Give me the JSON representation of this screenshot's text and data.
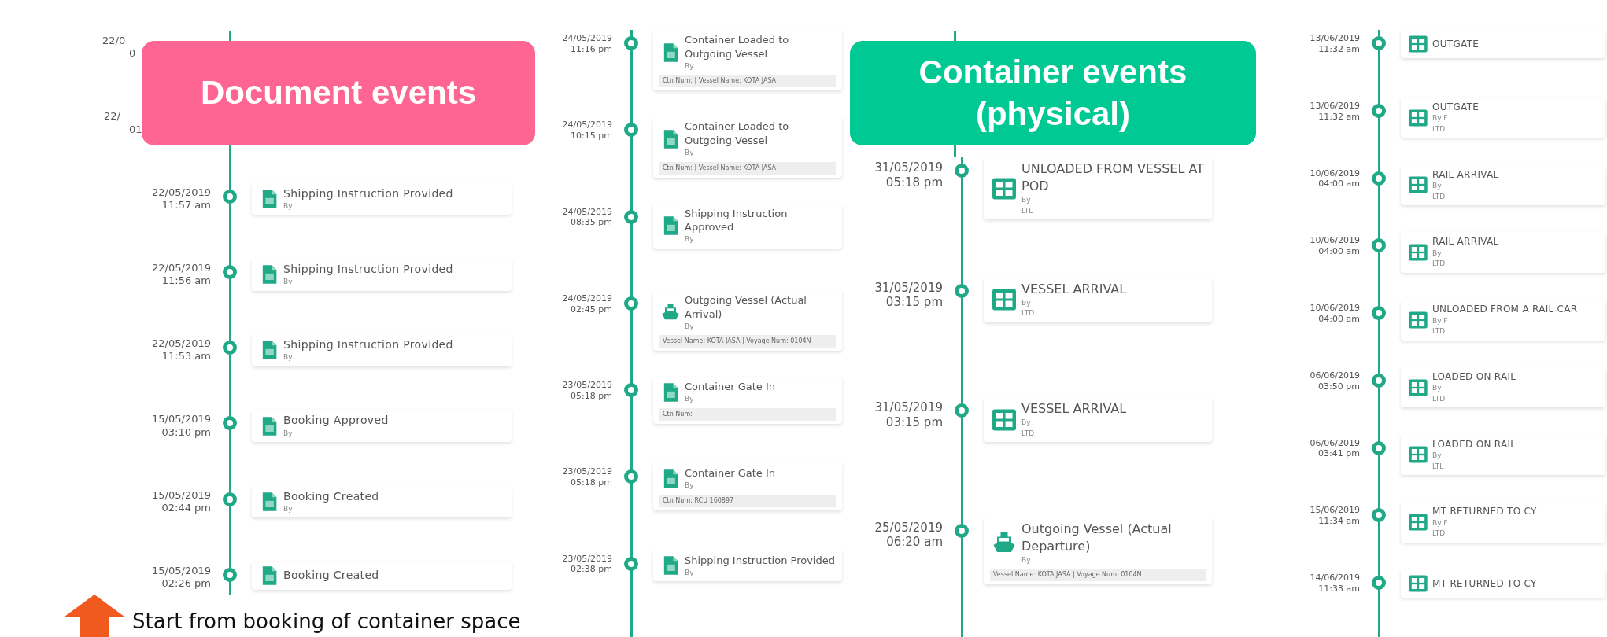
{
  "panels": [
    {
      "events": [
        {
          "date": "22/0",
          "time": "0",
          "kind": "covered"
        },
        {
          "date": "22/",
          "time": "01",
          "kind": "covered"
        },
        {
          "date": "22/05/2019",
          "time": "11:57 am",
          "kind": "document",
          "title": "Shipping Instruction Provided",
          "by": "By"
        },
        {
          "date": "22/05/2019",
          "time": "11:56 am",
          "kind": "document",
          "title": "Shipping Instruction Provided",
          "by": "By"
        },
        {
          "date": "22/05/2019",
          "time": "11:53 am",
          "kind": "document",
          "title": "Shipping Instruction Provided",
          "by": "By"
        },
        {
          "date": "15/05/2019",
          "time": "03:10 pm",
          "kind": "document",
          "title": "Booking Approved",
          "by": "By"
        },
        {
          "date": "15/05/2019",
          "time": "02:44 pm",
          "kind": "document",
          "title": "Booking Created",
          "by": "By"
        },
        {
          "date": "15/05/2019",
          "time": "02:26 pm",
          "kind": "document",
          "title": "Booking Created"
        }
      ]
    },
    {
      "events": [
        {
          "date": "24/05/2019",
          "time": "11:16 pm",
          "kind": "document",
          "title": "Container Loaded to Outgoing Vessel",
          "by": "By",
          "detail": "Ctn Num: | Vessel Name: KOTA JASA"
        },
        {
          "date": "24/05/2019",
          "time": "10:15 pm",
          "kind": "document",
          "title": "Container Loaded to Outgoing Vessel",
          "by": "By",
          "detail": "Ctn Num: | Vessel Name: KOTA JASA"
        },
        {
          "date": "24/05/2019",
          "time": "08:35 pm",
          "kind": "document",
          "title": "Shipping Instruction Approved",
          "by": "By"
        },
        {
          "date": "24/05/2019",
          "time": "02:45 pm",
          "kind": "ship",
          "title": "Outgoing Vessel (Actual Arrival)",
          "by": "By",
          "detail": "Vessel Name: KOTA JASA | Voyage Num: 0104N"
        },
        {
          "date": "23/05/2019",
          "time": "05:18 pm",
          "kind": "document",
          "title": "Container Gate In",
          "by": "By",
          "detail": "Ctn Num:"
        },
        {
          "date": "23/05/2019",
          "time": "05:18 pm",
          "kind": "document",
          "title": "Container Gate In",
          "by": "By",
          "detail": "Ctn Num: RCU 160897"
        },
        {
          "date": "23/05/2019",
          "time": "02:38 pm",
          "kind": "document",
          "title": "Shipping Instruction Provided",
          "by": "By"
        }
      ]
    },
    {
      "events": [
        {
          "date": "31/05/2019",
          "time": "05:18 pm",
          "kind": "grid",
          "title": "UNLOADED FROM VESSEL AT POD",
          "by": "By",
          "org": "LTL"
        },
        {
          "date": "31/05/2019",
          "time": "03:15 pm",
          "kind": "grid",
          "title": "VESSEL ARRIVAL",
          "by": "By",
          "org": "LTD"
        },
        {
          "date": "31/05/2019",
          "time": "03:15 pm",
          "kind": "grid",
          "title": "VESSEL ARRIVAL",
          "by": "By",
          "org": "LTD"
        },
        {
          "date": "25/05/2019",
          "time": "06:20 am",
          "kind": "ship",
          "title": "Outgoing Vessel (Actual Departure)",
          "by": "By",
          "detail": "Vessel Name: KOTA JASA | Voyage Num: 0104N"
        }
      ]
    },
    {
      "events": [
        {
          "date": "13/06/2019",
          "time": "11:32 am",
          "kind": "grid",
          "title": "OUTGATE"
        },
        {
          "date": "13/06/2019",
          "time": "11:32 am",
          "kind": "grid",
          "title": "OUTGATE",
          "by": "By F",
          "org": "LTD"
        },
        {
          "date": "10/06/2019",
          "time": "04:00 am",
          "kind": "grid",
          "title": "RAIL ARRIVAL",
          "by": "By",
          "org": "LTD"
        },
        {
          "date": "10/06/2019",
          "time": "04:00 am",
          "kind": "grid",
          "title": "RAIL ARRIVAL",
          "by": "By",
          "org": "LTD"
        },
        {
          "date": "10/06/2019",
          "time": "04:00 am",
          "kind": "grid",
          "title": "UNLOADED FROM A RAIL CAR",
          "by": "By F",
          "org": "LTD"
        },
        {
          "date": "06/06/2019",
          "time": "03:50 pm",
          "kind": "grid",
          "title": "LOADED ON RAIL",
          "by": "By",
          "org": "LTD"
        },
        {
          "date": "06/06/2019",
          "time": "03:41 pm",
          "kind": "grid",
          "title": "LOADED ON RAIL",
          "by": "By",
          "org": "LTL"
        },
        {
          "date": "15/06/2019",
          "time": "11:34 am",
          "kind": "grid",
          "title": "MT RETURNED TO CY",
          "by": "By F",
          "org": "LTD"
        },
        {
          "date": "14/06/2019",
          "time": "11:33 am",
          "kind": "grid",
          "title": "MT RETURNED TO CY"
        }
      ]
    }
  ],
  "callouts": [
    {
      "text": "Document events",
      "color": "#ff6593"
    },
    {
      "text": "Container events (physical)",
      "color": "#00c994"
    }
  ],
  "caption": "Start from booking of container space"
}
